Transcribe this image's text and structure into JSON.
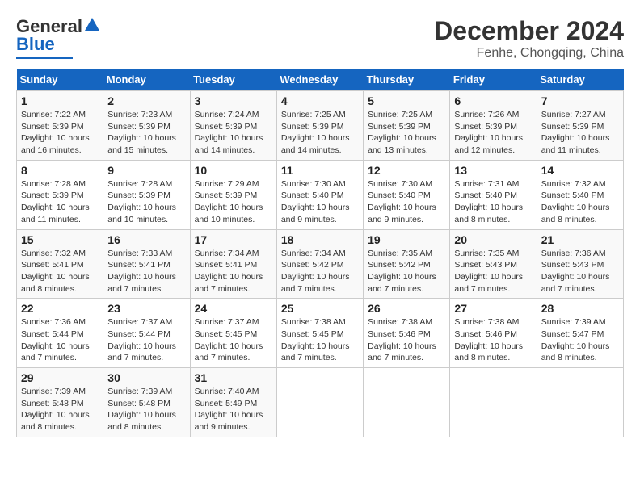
{
  "logo": {
    "line1": "General",
    "line2": "Blue"
  },
  "title": "December 2024",
  "subtitle": "Fenhe, Chongqing, China",
  "days_of_week": [
    "Sunday",
    "Monday",
    "Tuesday",
    "Wednesday",
    "Thursday",
    "Friday",
    "Saturday"
  ],
  "weeks": [
    [
      {
        "day": "1",
        "info": "Sunrise: 7:22 AM\nSunset: 5:39 PM\nDaylight: 10 hours and 16 minutes."
      },
      {
        "day": "2",
        "info": "Sunrise: 7:23 AM\nSunset: 5:39 PM\nDaylight: 10 hours and 15 minutes."
      },
      {
        "day": "3",
        "info": "Sunrise: 7:24 AM\nSunset: 5:39 PM\nDaylight: 10 hours and 14 minutes."
      },
      {
        "day": "4",
        "info": "Sunrise: 7:25 AM\nSunset: 5:39 PM\nDaylight: 10 hours and 14 minutes."
      },
      {
        "day": "5",
        "info": "Sunrise: 7:25 AM\nSunset: 5:39 PM\nDaylight: 10 hours and 13 minutes."
      },
      {
        "day": "6",
        "info": "Sunrise: 7:26 AM\nSunset: 5:39 PM\nDaylight: 10 hours and 12 minutes."
      },
      {
        "day": "7",
        "info": "Sunrise: 7:27 AM\nSunset: 5:39 PM\nDaylight: 10 hours and 11 minutes."
      }
    ],
    [
      {
        "day": "8",
        "info": "Sunrise: 7:28 AM\nSunset: 5:39 PM\nDaylight: 10 hours and 11 minutes."
      },
      {
        "day": "9",
        "info": "Sunrise: 7:28 AM\nSunset: 5:39 PM\nDaylight: 10 hours and 10 minutes."
      },
      {
        "day": "10",
        "info": "Sunrise: 7:29 AM\nSunset: 5:39 PM\nDaylight: 10 hours and 10 minutes."
      },
      {
        "day": "11",
        "info": "Sunrise: 7:30 AM\nSunset: 5:40 PM\nDaylight: 10 hours and 9 minutes."
      },
      {
        "day": "12",
        "info": "Sunrise: 7:30 AM\nSunset: 5:40 PM\nDaylight: 10 hours and 9 minutes."
      },
      {
        "day": "13",
        "info": "Sunrise: 7:31 AM\nSunset: 5:40 PM\nDaylight: 10 hours and 8 minutes."
      },
      {
        "day": "14",
        "info": "Sunrise: 7:32 AM\nSunset: 5:40 PM\nDaylight: 10 hours and 8 minutes."
      }
    ],
    [
      {
        "day": "15",
        "info": "Sunrise: 7:32 AM\nSunset: 5:41 PM\nDaylight: 10 hours and 8 minutes."
      },
      {
        "day": "16",
        "info": "Sunrise: 7:33 AM\nSunset: 5:41 PM\nDaylight: 10 hours and 7 minutes."
      },
      {
        "day": "17",
        "info": "Sunrise: 7:34 AM\nSunset: 5:41 PM\nDaylight: 10 hours and 7 minutes."
      },
      {
        "day": "18",
        "info": "Sunrise: 7:34 AM\nSunset: 5:42 PM\nDaylight: 10 hours and 7 minutes."
      },
      {
        "day": "19",
        "info": "Sunrise: 7:35 AM\nSunset: 5:42 PM\nDaylight: 10 hours and 7 minutes."
      },
      {
        "day": "20",
        "info": "Sunrise: 7:35 AM\nSunset: 5:43 PM\nDaylight: 10 hours and 7 minutes."
      },
      {
        "day": "21",
        "info": "Sunrise: 7:36 AM\nSunset: 5:43 PM\nDaylight: 10 hours and 7 minutes."
      }
    ],
    [
      {
        "day": "22",
        "info": "Sunrise: 7:36 AM\nSunset: 5:44 PM\nDaylight: 10 hours and 7 minutes."
      },
      {
        "day": "23",
        "info": "Sunrise: 7:37 AM\nSunset: 5:44 PM\nDaylight: 10 hours and 7 minutes."
      },
      {
        "day": "24",
        "info": "Sunrise: 7:37 AM\nSunset: 5:45 PM\nDaylight: 10 hours and 7 minutes."
      },
      {
        "day": "25",
        "info": "Sunrise: 7:38 AM\nSunset: 5:45 PM\nDaylight: 10 hours and 7 minutes."
      },
      {
        "day": "26",
        "info": "Sunrise: 7:38 AM\nSunset: 5:46 PM\nDaylight: 10 hours and 7 minutes."
      },
      {
        "day": "27",
        "info": "Sunrise: 7:38 AM\nSunset: 5:46 PM\nDaylight: 10 hours and 8 minutes."
      },
      {
        "day": "28",
        "info": "Sunrise: 7:39 AM\nSunset: 5:47 PM\nDaylight: 10 hours and 8 minutes."
      }
    ],
    [
      {
        "day": "29",
        "info": "Sunrise: 7:39 AM\nSunset: 5:48 PM\nDaylight: 10 hours and 8 minutes."
      },
      {
        "day": "30",
        "info": "Sunrise: 7:39 AM\nSunset: 5:48 PM\nDaylight: 10 hours and 8 minutes."
      },
      {
        "day": "31",
        "info": "Sunrise: 7:40 AM\nSunset: 5:49 PM\nDaylight: 10 hours and 9 minutes."
      },
      null,
      null,
      null,
      null
    ]
  ]
}
